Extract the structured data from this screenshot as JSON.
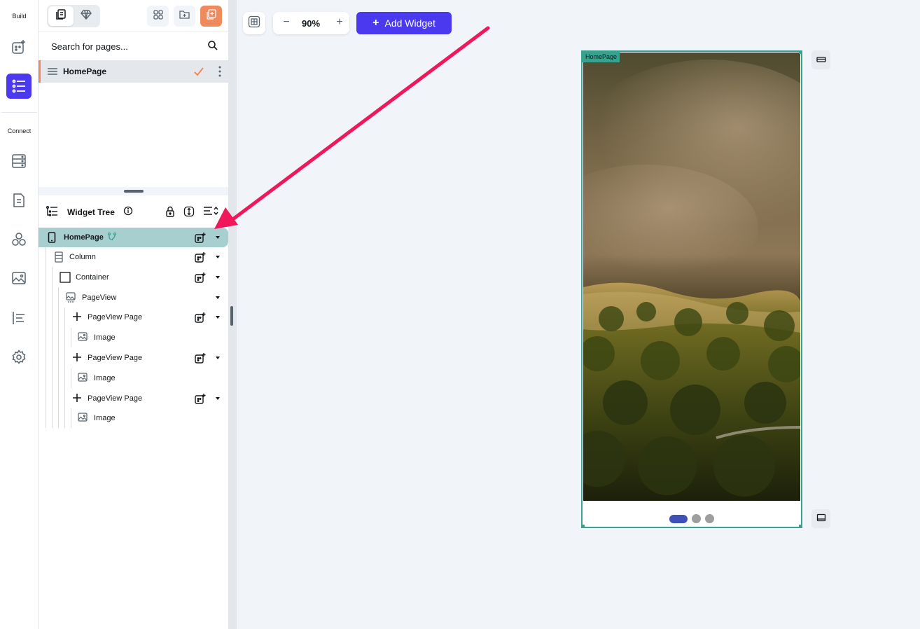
{
  "rail": {
    "build_label": "Build",
    "connect_label": "Connect",
    "icons": [
      "add-widget-icon",
      "widget-tree-icon",
      "database-icon",
      "storage-icon",
      "integrations-icon",
      "media-assets-icon",
      "api-icon",
      "settings-icon"
    ]
  },
  "pages_panel": {
    "search_placeholder": "Search for pages...",
    "pages": [
      {
        "name": "HomePage"
      }
    ]
  },
  "widget_tree": {
    "title": "Widget Tree",
    "nodes": [
      {
        "label": "HomePage",
        "icon": "phone-icon",
        "selected": true
      },
      {
        "label": "Column",
        "icon": "column-icon"
      },
      {
        "label": "Container",
        "icon": "container-icon"
      },
      {
        "label": "PageView",
        "icon": "pageview-icon"
      },
      {
        "label": "PageView Page",
        "icon": "plus-icon"
      },
      {
        "label": "Image",
        "icon": "image-icon"
      },
      {
        "label": "PageView Page",
        "icon": "plus-icon"
      },
      {
        "label": "Image",
        "icon": "image-icon"
      },
      {
        "label": "PageView Page",
        "icon": "plus-icon"
      },
      {
        "label": "Image",
        "icon": "image-icon"
      }
    ]
  },
  "toolbar": {
    "zoom_value": "90%",
    "zoom_minus": "−",
    "zoom_plus": "+",
    "add_widget_label": "Add Widget",
    "add_widget_plus": "+"
  },
  "canvas": {
    "page_label": "HomePage",
    "page_indicator": {
      "count": 3,
      "active": 0
    }
  },
  "colors": {
    "accent": "#4b39ef",
    "selection": "#39a28f",
    "orange": "#ef8a5c",
    "annotation_arrow": "#f0185a"
  }
}
